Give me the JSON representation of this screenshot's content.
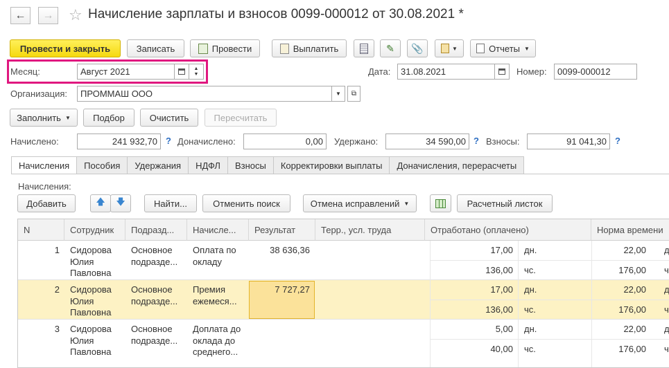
{
  "window": {
    "title": "Начисление зарплаты и взносов 0099-000012 от 30.08.2021 *"
  },
  "toolbar": {
    "post_close": "Провести и закрыть",
    "save": "Записать",
    "post": "Провести",
    "pay": "Выплатить",
    "reports": "Отчеты"
  },
  "header": {
    "month_label": "Месяц:",
    "month_value": "Август 2021",
    "date_label": "Дата:",
    "date_value": "31.08.2021",
    "number_label": "Номер:",
    "number_value": "0099-000012",
    "org_label": "Организация:",
    "org_value": "ПРОММАШ ООО"
  },
  "actions": {
    "fill": "Заполнить",
    "select": "Подбор",
    "clear": "Очистить",
    "recalc": "Пересчитать"
  },
  "totals": {
    "accrued_label": "Начислено:",
    "accrued_value": "241 932,70",
    "extra_label": "Доначислено:",
    "extra_value": "0,00",
    "withheld_label": "Удержано:",
    "withheld_value": "34 590,00",
    "contrib_label": "Взносы:",
    "contrib_value": "91 041,30",
    "help": "?"
  },
  "tabs": [
    "Начисления",
    "Пособия",
    "Удержания",
    "НДФЛ",
    "Взносы",
    "Корректировки выплаты",
    "Доначисления, перерасчеты"
  ],
  "accruals": {
    "section_label": "Начисления:",
    "add": "Добавить",
    "find": "Найти...",
    "cancel_search": "Отменить поиск",
    "cancel_fixes": "Отмена исправлений",
    "payslip": "Расчетный листок"
  },
  "table": {
    "columns": [
      "N",
      "Сотрудник",
      "Подразд...",
      "Начисле...",
      "Результат",
      "Терр., усл. труда",
      "Отработано (оплачено)",
      "Норма времени"
    ],
    "rows": [
      {
        "n": "1",
        "emp1": "Сидорова",
        "emp2": "Юлия",
        "emp3": "Павловна",
        "dep1": "Основное",
        "dep2": "подразде...",
        "acc1": "Оплата по",
        "acc2": "окладу",
        "acc3": "",
        "result": "38 636,36",
        "worked_days": "17,00",
        "worked_hours": "136,00",
        "unit_days": "дн.",
        "unit_hours": "чс.",
        "norm_days": "22,00",
        "norm_hours": "176,00"
      },
      {
        "n": "2",
        "emp1": "Сидорова",
        "emp2": "Юлия",
        "emp3": "Павловна",
        "dep1": "Основное",
        "dep2": "подразде...",
        "acc1": "Премия",
        "acc2": "ежемеся...",
        "acc3": "",
        "result": "7 727,27",
        "worked_days": "17,00",
        "worked_hours": "136,00",
        "unit_days": "дн.",
        "unit_hours": "чс.",
        "norm_days": "22,00",
        "norm_hours": "176,00"
      },
      {
        "n": "3",
        "emp1": "Сидорова",
        "emp2": "Юлия",
        "emp3": "Павловна",
        "dep1": "Основное",
        "dep2": "подразде...",
        "acc1": "Доплата до",
        "acc2": "оклада до",
        "acc3": "среднего...",
        "result": "",
        "worked_days": "5,00",
        "worked_hours": "40,00",
        "unit_days": "дн.",
        "unit_hours": "чс.",
        "norm_days": "22,00",
        "norm_hours": "176,00"
      }
    ]
  },
  "colors": {
    "primary_button": "#f5d90f",
    "highlight_box": "#e0177f",
    "selected_row": "#fdf2c4",
    "result_cell": "#fbe29a",
    "help_link": "#2d6ec2"
  }
}
